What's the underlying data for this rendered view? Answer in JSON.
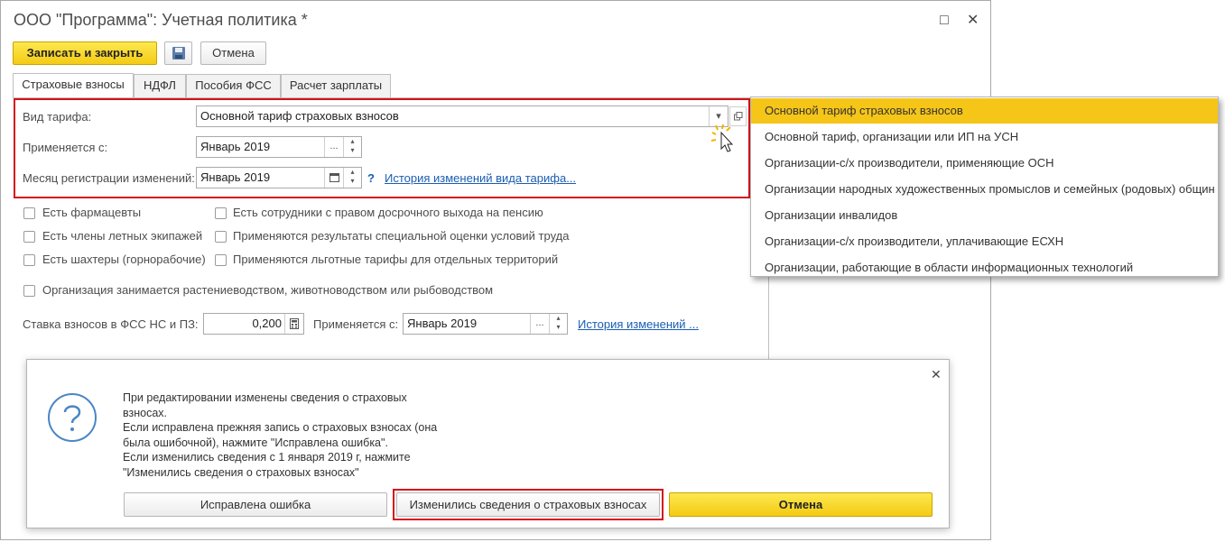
{
  "window": {
    "title": "ООО \"Программа\": Учетная политика *",
    "maximize_glyph": "□",
    "close_glyph": "✕"
  },
  "toolbar": {
    "save_close_label": "Записать и закрыть",
    "save_icon": "floppy-disk-icon",
    "cancel_label": "Отмена"
  },
  "tabs": [
    {
      "label": "Страховые взносы",
      "active": true
    },
    {
      "label": "НДФЛ",
      "active": false
    },
    {
      "label": "Пособия ФСС",
      "active": false
    },
    {
      "label": "Расчет зарплаты",
      "active": false
    }
  ],
  "tariff": {
    "type_label": "Вид тарифа:",
    "type_value": "Основной тариф страховых взносов",
    "applies_label": "Применяется с:",
    "applies_value": "Январь 2019",
    "reg_month_label": "Месяц регистрации изменений:",
    "reg_month_value": "Январь 2019",
    "help_mark": "?",
    "history_link": "История изменений вида тарифа..."
  },
  "checkboxes": {
    "col1": [
      "Есть фармацевты",
      "Есть члены летных экипажей",
      "Есть шахтеры (горнорабочие)"
    ],
    "col2": [
      "Есть сотрудники с правом досрочного выхода на пенсию",
      "Применяются результаты специальной оценки условий труда",
      "Применяются льготные тарифы для отдельных территорий"
    ],
    "agro": "Организация занимается растениеводством, животноводством или рыбоводством"
  },
  "fss": {
    "rate_label": "Ставка взносов в ФСС НС и ПЗ:",
    "rate_value": "0,200",
    "applies_label": "Применяется с:",
    "applies_value": "Январь 2019",
    "history_link": "История изменений ..."
  },
  "dropdown": {
    "items": [
      "Основной тариф страховых взносов",
      "Основной тариф, организации или ИП на УСН",
      "Организации-с/х производители, применяющие ОСН",
      "Организации народных художественных промыслов и семейных (родовых) общин",
      "Организации инвалидов",
      "Организации-с/х производители, уплачивающие ЕСХН",
      "Организации, работающие в области информационных технологий"
    ],
    "selected_index": 0,
    "highlight_color": "#f5c518"
  },
  "dialog": {
    "icon": "question-circle-icon",
    "lines": [
      "При редактировании изменены сведения о страховых",
      "взносах.",
      "Если исправлена прежняя запись о страховых взносах (она",
      "была ошибочной), нажмите \"Исправлена ошибка\".",
      "Если изменились сведения с 1 января 2019 г, нажмите",
      "\"Изменились сведения о страховых взносах\""
    ],
    "btn_fixed_error": "Исправлена ошибка",
    "btn_changed": "Изменились сведения о страховых взносах",
    "btn_cancel": "Отмена",
    "close_glyph": "✕"
  },
  "colors": {
    "accent_yellow": "#f5c518",
    "highlight_red": "#d4121c",
    "link_blue": "#1b5db4"
  }
}
